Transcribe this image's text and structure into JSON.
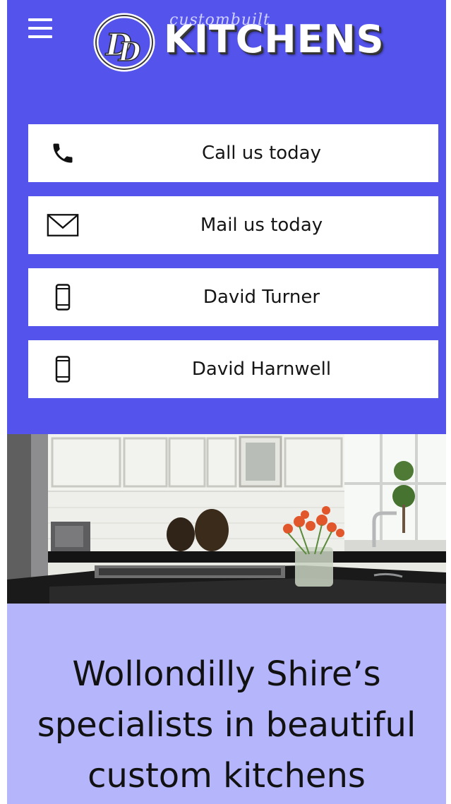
{
  "header": {
    "logo_script": "custombuilt",
    "logo_text": "KITCHENS",
    "logo_mark_alt": "DD monogram"
  },
  "contacts": [
    {
      "label": "Call us today",
      "icon": "phone-icon"
    },
    {
      "label": "Mail us today",
      "icon": "mail-icon"
    },
    {
      "label": "David Turner",
      "icon": "mobile-icon"
    },
    {
      "label": "David Harnwell",
      "icon": "mobile-icon"
    }
  ],
  "hero": {
    "subject": "kitchen-photo"
  },
  "tagline": "Wollondilly Shire’s specialists in beautiful custom kitchens",
  "colors": {
    "header_bg": "#5454ec",
    "tagline_bg": "#b5b5fb",
    "button_bg": "#ffffff",
    "text": "#151515"
  }
}
